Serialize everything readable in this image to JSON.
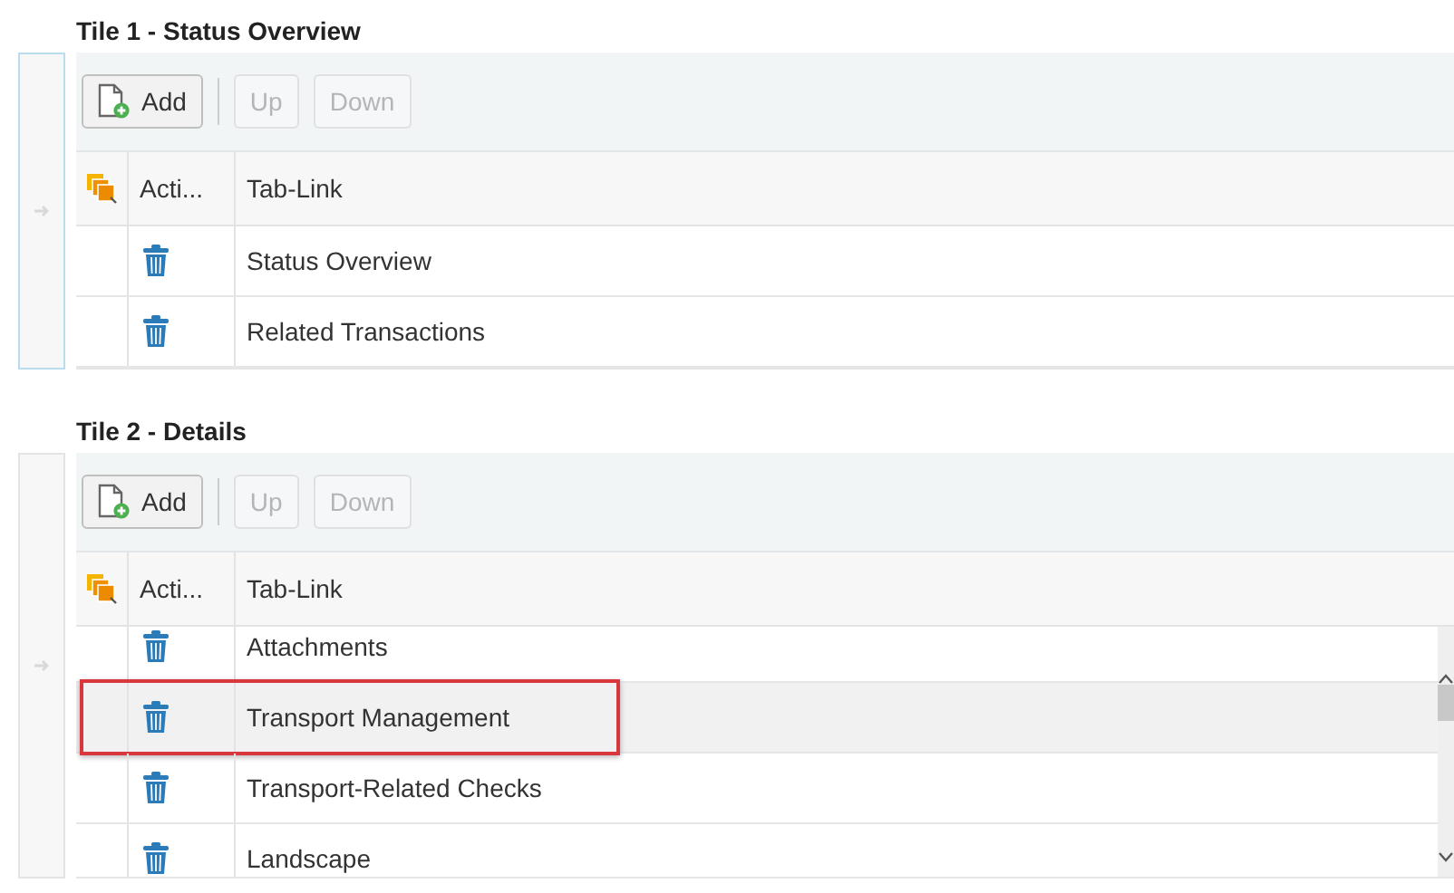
{
  "tiles": [
    {
      "title": "Tile 1 - Status Overview",
      "selected": true,
      "scrollbar": false,
      "toolbar": [
        {
          "label": "Add",
          "kind": "add",
          "disabled": false
        },
        {
          "label": "Up",
          "kind": "plain",
          "disabled": true
        },
        {
          "label": "Down",
          "kind": "plain",
          "disabled": true
        }
      ],
      "columns": [
        "Acti...",
        "Tab-Link"
      ],
      "rows": [
        {
          "tab_link": "Status Overview",
          "highlighted": false
        },
        {
          "tab_link": "Related Transactions",
          "highlighted": false
        }
      ]
    },
    {
      "title": "Tile 2 - Details",
      "selected": false,
      "scrollbar": true,
      "toolbar": [
        {
          "label": "Add",
          "kind": "add",
          "disabled": false
        },
        {
          "label": "Up",
          "kind": "plain",
          "disabled": true
        },
        {
          "label": "Down",
          "kind": "plain",
          "disabled": true
        }
      ],
      "columns": [
        "Acti...",
        "Tab-Link"
      ],
      "rows": [
        {
          "tab_link": "Attachments",
          "highlighted": false
        },
        {
          "tab_link": "Transport Management",
          "highlighted": true
        },
        {
          "tab_link": "Transport-Related Checks",
          "highlighted": false
        },
        {
          "tab_link": "Landscape",
          "highlighted": false
        }
      ]
    }
  ]
}
